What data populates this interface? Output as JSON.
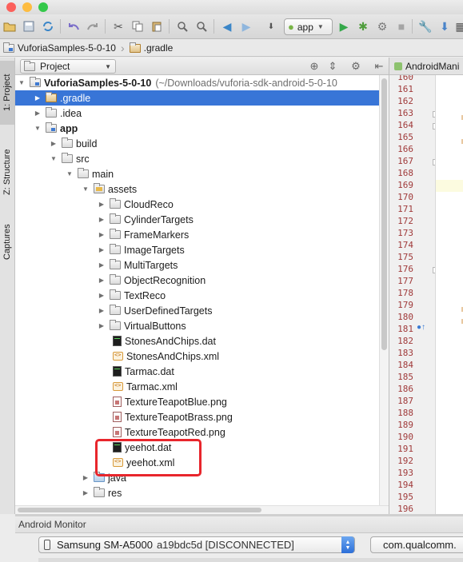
{
  "window": {
    "traffic_lights": [
      "#fc605b",
      "#fdbc40",
      "#34c84a"
    ]
  },
  "toolbar": {
    "run_config": "app",
    "icons": [
      "open-icon",
      "save-icon",
      "sync-icon",
      "undo-icon",
      "redo-icon",
      "cut-icon",
      "copy-icon",
      "paste-icon",
      "find-icon",
      "replace-icon",
      "back-icon",
      "forward-icon",
      "make-project-icon",
      "run-icon",
      "debug-icon",
      "attach-icon",
      "stop-icon",
      "sdk-manager-icon",
      "avd-manager-icon",
      "project-structure-icon"
    ]
  },
  "breadcrumb": {
    "items": [
      "VuforiaSamples-5-0-10",
      ".gradle"
    ]
  },
  "left_stripe": {
    "tabs": [
      "1: Project",
      "Z: Structure",
      "Captures"
    ]
  },
  "project_panel": {
    "view_mode": "Project",
    "tree": [
      {
        "label": "VuforiaSamples-5-0-10",
        "sub": "(~/Downloads/vuforia-sdk-android-5-0-10",
        "bold": true
      },
      {
        "label": ".gradle",
        "selected": true
      },
      {
        "label": ".idea"
      },
      {
        "label": "app",
        "bold": true
      },
      {
        "label": "build"
      },
      {
        "label": "src"
      },
      {
        "label": "main"
      },
      {
        "label": "assets"
      },
      {
        "label": "CloudReco"
      },
      {
        "label": "CylinderTargets"
      },
      {
        "label": "FrameMarkers"
      },
      {
        "label": "ImageTargets"
      },
      {
        "label": "MultiTargets"
      },
      {
        "label": "ObjectRecognition"
      },
      {
        "label": "TextReco"
      },
      {
        "label": "UserDefinedTargets"
      },
      {
        "label": "VirtualButtons"
      },
      {
        "label": "StonesAndChips.dat"
      },
      {
        "label": "StonesAndChips.xml"
      },
      {
        "label": "Tarmac.dat"
      },
      {
        "label": "Tarmac.xml"
      },
      {
        "label": "TextureTeapotBlue.png"
      },
      {
        "label": "TextureTeapotBrass.png"
      },
      {
        "label": "TextureTeapotRed.png"
      },
      {
        "label": "yeehot.dat"
      },
      {
        "label": "yeehot.xml"
      },
      {
        "label": "java"
      },
      {
        "label": "res"
      }
    ]
  },
  "editor": {
    "tab_label": "AndroidMani",
    "line_numbers": [
      "160",
      "161",
      "162",
      "163",
      "164",
      "165",
      "166",
      "167",
      "168",
      "169",
      "170",
      "171",
      "172",
      "173",
      "174",
      "175",
      "176",
      "177",
      "178",
      "179",
      "180",
      "181",
      "182",
      "183",
      "184",
      "185",
      "186",
      "187",
      "188",
      "189",
      "190",
      "191",
      "192",
      "193",
      "194",
      "195",
      "196"
    ]
  },
  "android_monitor": {
    "title": "Android Monitor",
    "device_name": "Samsung SM-A5000",
    "device_serial": "a19bdc5d [DISCONNECTED]",
    "process": "com.qualcomm."
  },
  "colors": {
    "selection": "#3875d7",
    "highlight_box": "#e8262c",
    "line_number": "#a03a3a"
  }
}
